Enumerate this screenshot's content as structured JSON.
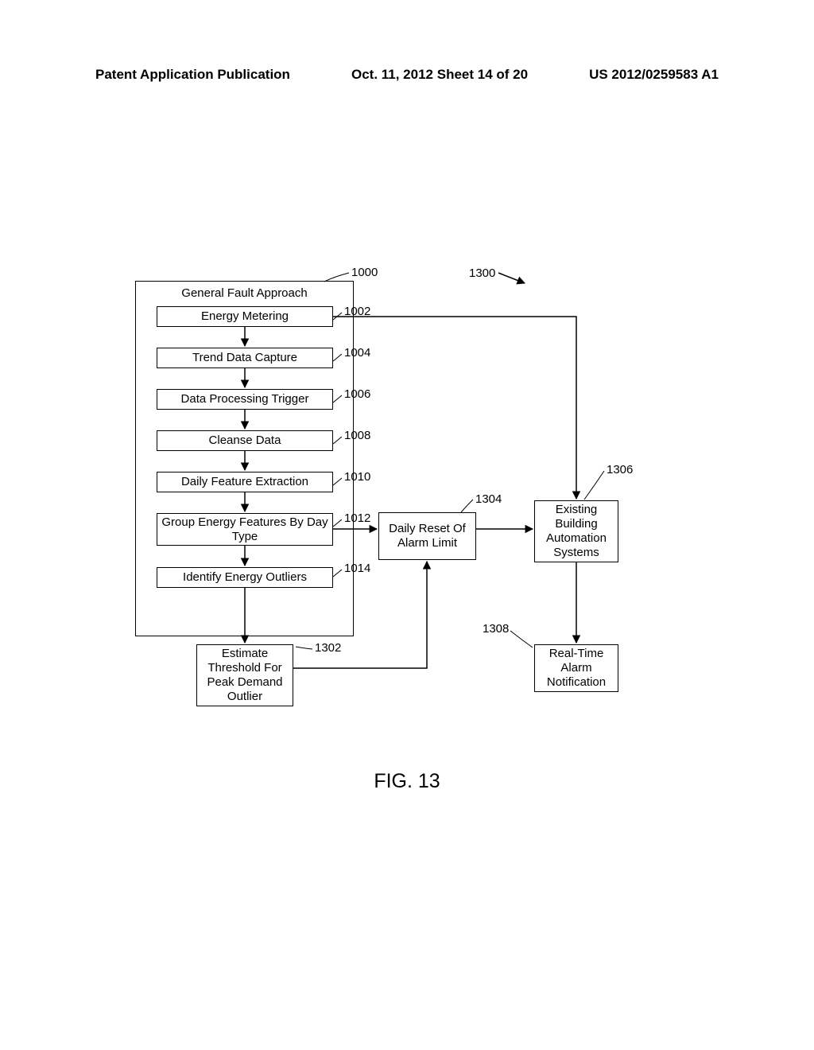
{
  "header": {
    "left": "Patent Application Publication",
    "center": "Oct. 11, 2012  Sheet 14 of 20",
    "right": "US 2012/0259583 A1"
  },
  "figure_label": "FIG. 13",
  "refs": {
    "r1000": "1000",
    "r1002": "1002",
    "r1004": "1004",
    "r1006": "1006",
    "r1008": "1008",
    "r1010": "1010",
    "r1012": "1012",
    "r1014": "1014",
    "r1300": "1300",
    "r1302": "1302",
    "r1304": "1304",
    "r1306": "1306",
    "r1308": "1308"
  },
  "boxes": {
    "outer_title": "General Fault Approach",
    "b1002": "Energy Metering",
    "b1004": "Trend Data Capture",
    "b1006": "Data Processing Trigger",
    "b1008": "Cleanse Data",
    "b1010": "Daily Feature Extraction",
    "b1012": "Group Energy Features By Day Type",
    "b1014": "Identify Energy Outliers",
    "b1302": "Estimate Threshold For Peak Demand Outlier",
    "b1304": "Daily Reset Of Alarm Limit",
    "b1306": "Existing Building Automation Systems",
    "b1308": "Real-Time Alarm Notification"
  }
}
